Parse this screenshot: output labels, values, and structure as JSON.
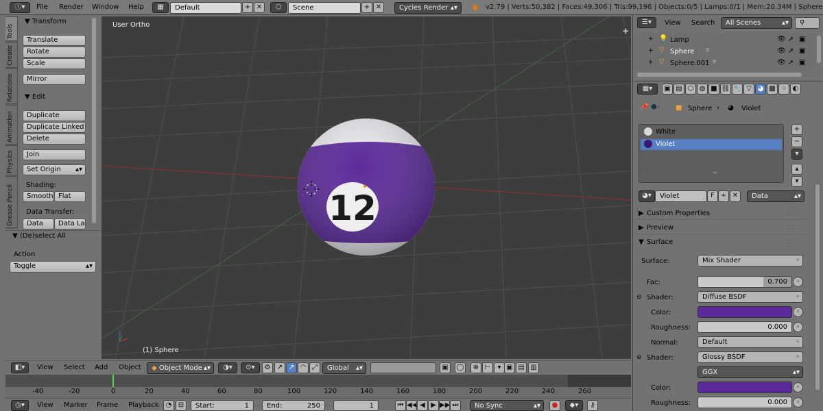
{
  "topbar": {
    "menus": [
      "File",
      "Render",
      "Window",
      "Help"
    ],
    "layout": "Default",
    "scene": "Scene",
    "engine": "Cycles Render",
    "stats": "v2.79 | Verts:50,382 | Faces:49,306 | Tris:99,196 | Objects:0/5 | Lamps:0/1 | Mem:20.34M | Sphere"
  },
  "toolshelf": {
    "tabs": [
      "Tools",
      "Create",
      "Relations",
      "Animation",
      "Physics",
      "Grease Pencil"
    ],
    "transform_header": "Transform",
    "translate": "Translate",
    "rotate": "Rotate",
    "scale": "Scale",
    "mirror": "Mirror",
    "edit_header": "Edit",
    "duplicate": "Duplicate",
    "duplicate_linked": "Duplicate Linked",
    "delete": "Delete",
    "join": "Join",
    "set_origin": "Set Origin",
    "shading_label": "Shading:",
    "smooth": "Smooth",
    "flat": "Flat",
    "data_transfer_label": "Data Transfer:",
    "data": "Data",
    "data_la": "Data La",
    "deselect_header": "(De)select All",
    "action_label": "Action",
    "toggle": "Toggle"
  },
  "viewport": {
    "view_label": "User Ortho",
    "object_label": "(1) Sphere",
    "ball_number": "12",
    "colors": {
      "stripe": "#5b2a9a",
      "white": "#e6e6ec"
    }
  },
  "view3d_header": {
    "menus": [
      "View",
      "Select",
      "Add",
      "Object"
    ],
    "mode": "Object Mode",
    "orientation": "Global"
  },
  "timeline": {
    "ticks": [
      "-40",
      "-20",
      "0",
      "20",
      "40",
      "60",
      "80",
      "100",
      "120",
      "140",
      "160",
      "180",
      "200",
      "220",
      "240",
      "260"
    ],
    "menus": [
      "View",
      "Marker",
      "Frame",
      "Playback"
    ],
    "start_label": "Start:",
    "start_value": "1",
    "end_label": "End:",
    "end_value": "250",
    "current_frame": "1",
    "sync": "No Sync"
  },
  "outliner": {
    "menus": [
      "View",
      "Search"
    ],
    "filter": "All Scenes",
    "items": [
      "Lamp",
      "Sphere",
      "Sphere.001"
    ]
  },
  "properties": {
    "breadcrumb": [
      "Sphere",
      "Violet"
    ],
    "material_slots": [
      "White",
      "Violet"
    ],
    "material_name": "Violet",
    "fake_user": "F",
    "link": "Data",
    "custom_properties": "Custom Properties",
    "preview": "Preview",
    "surface_header": "Surface",
    "surface_label": "Surface:",
    "surface_value": "Mix Shader",
    "fac_label": "Fac:",
    "fac_value": "0.700",
    "fac": 0.7,
    "shader1_label": "Shader:",
    "shader1_value": "Diffuse BSDF",
    "color1_label": "Color:",
    "roughness1_label": "Roughness:",
    "roughness1_value": "0.000",
    "normal_label": "Normal:",
    "normal_value": "Default",
    "shader2_label": "Shader:",
    "shader2_value": "Glossy BSDF",
    "distribution": "GGX",
    "color2_label": "Color:",
    "roughness2_label": "Roughness:",
    "roughness2_value": "0.000",
    "accent": "#5b2a9a",
    "selection": "#5680c2"
  }
}
